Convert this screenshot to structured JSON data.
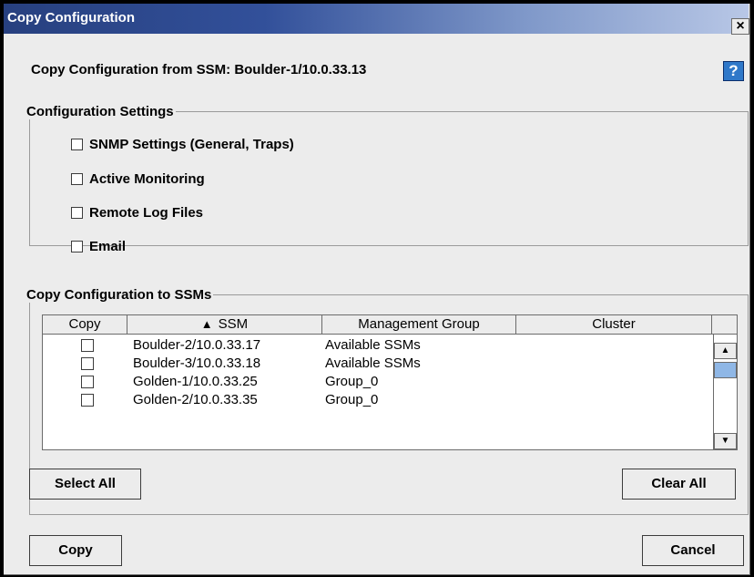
{
  "window": {
    "title": "Copy Configuration",
    "close_label": "×",
    "help_label": "?"
  },
  "source": {
    "label": "Copy Configuration from SSM:  Boulder-1/10.0.33.13"
  },
  "settings": {
    "legend": "Configuration Settings",
    "options": [
      {
        "label": "SNMP Settings (General, Traps)",
        "checked": false
      },
      {
        "label": "Active Monitoring",
        "checked": false
      },
      {
        "label": "Remote Log Files",
        "checked": false
      },
      {
        "label": "Email",
        "checked": false
      }
    ]
  },
  "targets": {
    "legend": "Copy Configuration to SSMs",
    "columns": [
      "Copy",
      "SSM",
      "Management Group",
      "Cluster"
    ],
    "sort_icon": "sort-ascending-icon",
    "rows": [
      {
        "copy": false,
        "ssm": "Boulder-2/10.0.33.17",
        "group": "Available SSMs",
        "cluster": ""
      },
      {
        "copy": false,
        "ssm": "Boulder-3/10.0.33.18",
        "group": "Available SSMs",
        "cluster": ""
      },
      {
        "copy": false,
        "ssm": "Golden-1/10.0.33.25",
        "group": "Group_0",
        "cluster": ""
      },
      {
        "copy": false,
        "ssm": "Golden-2/10.0.33.35",
        "group": "Group_0",
        "cluster": ""
      }
    ],
    "select_all_label": "Select All",
    "clear_all_label": "Clear All"
  },
  "footer": {
    "copy_label": "Copy",
    "cancel_label": "Cancel"
  },
  "colors": {
    "titlebar_start": "#27407f",
    "titlebar_end": "#b8c7e6",
    "dialog_bg": "#ececec",
    "help_bg": "#2f78c9"
  }
}
